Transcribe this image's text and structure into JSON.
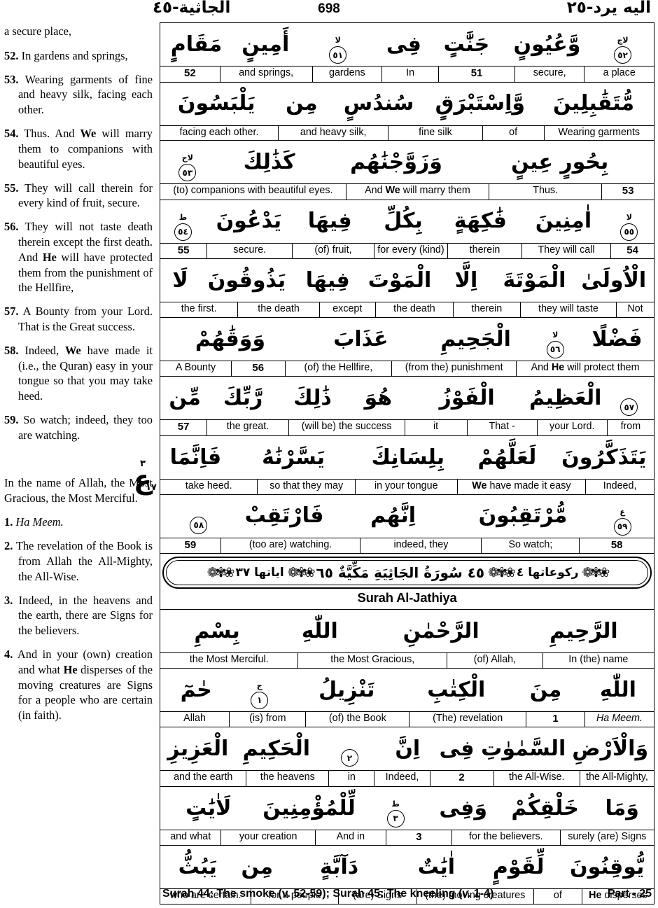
{
  "header": {
    "surah_arabic": "الجاثية-٤٥",
    "page_number": "698",
    "juz_arabic": "اليه يرد-٢٥"
  },
  "hizb_marker": {
    "top": "٣",
    "mid": "ع",
    "bottom": "١٧"
  },
  "left_column": {
    "paragraphs": [
      {
        "num": "",
        "text": "a secure place,",
        "style": "cont"
      },
      {
        "num": "52.",
        "text": "In gardens and springs,"
      },
      {
        "num": "53.",
        "text": "Wearing garments of fine and heavy silk, facing each other."
      },
      {
        "num": "54.",
        "text": "Thus. And <b>We</b> will marry them to companions with beautiful eyes."
      },
      {
        "num": "55.",
        "text": "They will call therein for every kind of fruit, secure."
      },
      {
        "num": "56.",
        "text": "They will not taste death therein except the first death. And <b>He</b> will have protected them from the punishment of the Hellfire,"
      },
      {
        "num": "57.",
        "text": "A Bounty from your Lord. That is the Great success."
      },
      {
        "num": "58.",
        "text": "Indeed, <b>We</b> have made it (i.e., the Quran) easy in your tongue so that you may take heed."
      },
      {
        "num": "59.",
        "text": "So watch; indeed, they too are watching."
      },
      {
        "num": "",
        "text": "",
        "style": "gap"
      },
      {
        "num": "",
        "text": "In the name of Allah, the Most Gracious, the Most Merciful.",
        "style": "cont"
      },
      {
        "num": "1.",
        "text": "<i>Ha Meem.</i>"
      },
      {
        "num": "2.",
        "text": "The revelation of the Book is from Allah the All-Mighty, the All-Wise."
      },
      {
        "num": "3.",
        "text": "Indeed, in the heavens and the earth, there are Signs for the believers."
      },
      {
        "num": "4.",
        "text": "And in your (own) creation and what <b>He</b> disperses of the moving creatures are Signs for a people who are certain (in faith)."
      }
    ]
  },
  "table": {
    "rows": [
      {
        "type": "ayah",
        "arabic": [
          {
            "w": "مَقَامٍ",
            "flex": 1
          },
          {
            "w": "أَمِينٍ",
            "flex": 1
          },
          {
            "w": "۝٥١",
            "mark": "٥١",
            "sup": "لا",
            "flex": 1.1
          },
          {
            "w": "فِى",
            "flex": 0.8
          },
          {
            "w": "جَنَّٰتٍ",
            "flex": 1
          },
          {
            "w": "وَّعُيُونٍ",
            "flex": 1.35
          },
          {
            "w": "۝٥٢",
            "mark": "٥٢",
            "sup": "لاج",
            "flex": 0.85
          }
        ],
        "english": [
          {
            "t": "a place",
            "flex": 1
          },
          {
            "t": "secure,",
            "flex": 1
          },
          {
            "t": "51",
            "flex": 1.1,
            "num": true
          },
          {
            "t": "In",
            "flex": 0.8
          },
          {
            "t": "gardens",
            "flex": 1
          },
          {
            "t": "and springs,",
            "flex": 1.35
          },
          {
            "t": "52",
            "flex": 0.85,
            "num": true
          }
        ]
      },
      {
        "type": "ayah",
        "arabic": [
          {
            "w": "يَلْبَسُونَ",
            "flex": 1.3
          },
          {
            "w": "مِن",
            "flex": 0.7
          },
          {
            "w": "سُندُسٍ",
            "flex": 1.1
          },
          {
            "w": "وَّاِسْتَبْرَقٍ",
            "flex": 1.3
          },
          {
            "w": "مُّتَقَٰبِلِينَ",
            "flex": 1.4
          }
        ],
        "english": [
          {
            "t": "Wearing garments",
            "flex": 1.3
          },
          {
            "t": "of",
            "flex": 0.7
          },
          {
            "t": "fine silk",
            "flex": 1.1
          },
          {
            "t": "and heavy silk,",
            "flex": 1.3
          },
          {
            "t": "facing each other.",
            "flex": 1.4
          }
        ]
      },
      {
        "type": "ayah",
        "arabic": [
          {
            "w": "۝٥٣",
            "mark": "٥٣",
            "sup": "لاج",
            "flex": 0.55
          },
          {
            "w": "كَذَٰلِكَ",
            "flex": 1.25
          },
          {
            "w": "وَزَوَّجْنَٰهُم",
            "flex": 1.6
          },
          {
            "w": "بِحُورٍ عِينٍ",
            "flex": 2.1
          }
        ],
        "english": [
          {
            "t": "53",
            "flex": 0.55,
            "num": true
          },
          {
            "t": "Thus.",
            "flex": 1.25
          },
          {
            "t": "And <b>We</b> will marry them",
            "flex": 1.6
          },
          {
            "t": "(to) companions with beautiful eyes.",
            "flex": 2.1
          }
        ]
      },
      {
        "type": "ayah",
        "arabic": [
          {
            "w": "۝٥٤",
            "mark": "٥٤",
            "sup": "ط",
            "flex": 0.5
          },
          {
            "w": "يَدْعُونَ",
            "flex": 1.1
          },
          {
            "w": "فِيهَا",
            "flex": 0.9
          },
          {
            "w": "بِكُلِّ",
            "flex": 0.9
          },
          {
            "w": "فَٰكِهَةٍ",
            "flex": 1
          },
          {
            "w": "اٰمِنِينَ",
            "flex": 1.05
          },
          {
            "w": "۝٥٥",
            "mark": "٥٥",
            "sup": "لا",
            "flex": 0.55
          }
        ],
        "english": [
          {
            "t": "54",
            "flex": 0.5,
            "num": true
          },
          {
            "t": "They will call",
            "flex": 1.1
          },
          {
            "t": "therein",
            "flex": 0.9
          },
          {
            "t": "for every (kind)",
            "flex": 0.9
          },
          {
            "t": "(of) fruit,",
            "flex": 1
          },
          {
            "t": "secure.",
            "flex": 1.05
          },
          {
            "t": "55",
            "flex": 0.55,
            "num": true
          }
        ]
      },
      {
        "type": "ayah",
        "arabic": [
          {
            "w": "لَا",
            "flex": 0.45
          },
          {
            "w": "يَذُوقُونَ",
            "flex": 1.25
          },
          {
            "w": "فِيهَا",
            "flex": 0.85
          },
          {
            "w": "الْمَوْتَ",
            "flex": 1
          },
          {
            "w": "اِلَّا",
            "flex": 0.7
          },
          {
            "w": "الْمَوْتَةَ",
            "flex": 1.05
          },
          {
            "w": "الْاُولَىٰ",
            "flex": 1
          }
        ],
        "english": [
          {
            "t": "Not",
            "flex": 0.45
          },
          {
            "t": "they will taste",
            "flex": 1.25
          },
          {
            "t": "therein",
            "flex": 0.85
          },
          {
            "t": "the death",
            "flex": 1
          },
          {
            "t": "except",
            "flex": 0.7
          },
          {
            "t": "the death",
            "flex": 1.05
          },
          {
            "t": "the first.",
            "flex": 1
          }
        ]
      },
      {
        "type": "ayah",
        "arabic": [
          {
            "w": "وَوَقَٰهُمْ",
            "flex": 1.5
          },
          {
            "w": "عَذَابَ",
            "flex": 1.35
          },
          {
            "w": "الْجَحِيمِ",
            "flex": 1.15
          },
          {
            "w": "۝٥٦",
            "mark": "٥٦",
            "sup": "لا",
            "flex": 0.55
          },
          {
            "w": "فَضْلًا",
            "flex": 0.75
          }
        ],
        "english": [
          {
            "t": "And <b>He</b> will protect them",
            "flex": 1.5
          },
          {
            "t": "(from the) punishment",
            "flex": 1.35
          },
          {
            "t": "(of) the Hellfire,",
            "flex": 1.15
          },
          {
            "t": "56",
            "flex": 0.55,
            "num": true
          },
          {
            "t": "A Bounty",
            "flex": 0.75
          }
        ]
      },
      {
        "type": "ayah",
        "arabic": [
          {
            "w": "مِّن",
            "flex": 0.55
          },
          {
            "w": "رَّبِّكَ",
            "flex": 0.85
          },
          {
            "w": "ذَٰلِكَ",
            "flex": 0.85
          },
          {
            "w": "هُوَ",
            "flex": 0.75
          },
          {
            "w": "الْفَوْزُ",
            "flex": 1.45
          },
          {
            "w": "الْعَظِيمُ",
            "flex": 1
          },
          {
            "w": "۝٥٧",
            "mark": "٥٧",
            "sup": "",
            "flex": 0.55
          }
        ],
        "english": [
          {
            "t": "from",
            "flex": 0.55
          },
          {
            "t": "your Lord.",
            "flex": 0.85
          },
          {
            "t": "That -",
            "flex": 0.85
          },
          {
            "t": "it",
            "flex": 0.75
          },
          {
            "t": "(will be) the success",
            "flex": 1.45
          },
          {
            "t": "the great.",
            "flex": 1
          },
          {
            "t": "57",
            "flex": 0.55,
            "num": true
          }
        ]
      },
      {
        "type": "ayah",
        "arabic": [
          {
            "w": "فَاِنَّمَا",
            "flex": 0.72
          },
          {
            "w": "يَسَّرْنَٰهُ",
            "flex": 1.4
          },
          {
            "w": "بِلِسَانِكَ",
            "flex": 1.1
          },
          {
            "w": "لَعَلَّهُمْ",
            "flex": 1.05
          },
          {
            "w": "يَتَذَكَّرُونَ",
            "flex": 1.05
          }
        ],
        "english": [
          {
            "t": "Indeed,",
            "flex": 0.72
          },
          {
            "t": "<b>We</b> have made it easy",
            "flex": 1.4
          },
          {
            "t": "in your tongue",
            "flex": 1.1
          },
          {
            "t": "so that they may",
            "flex": 1.05
          },
          {
            "t": "take heed.",
            "flex": 1.05
          }
        ]
      },
      {
        "type": "ayah",
        "arabic": [
          {
            "w": "۝٥٨",
            "mark": "٥٨",
            "sup": "",
            "flex": 0.75
          },
          {
            "w": "فَارْتَقِبْ",
            "flex": 1
          },
          {
            "w": "اِنَّهُم",
            "flex": 1.25
          },
          {
            "w": "مُّرْتَقِبُونَ",
            "flex": 1.45
          },
          {
            "w": "۝٥٩",
            "mark": "٥٩",
            "sup": "ع",
            "flex": 0.6
          }
        ],
        "english": [
          {
            "t": "58",
            "flex": 0.75,
            "num": true
          },
          {
            "t": "So watch;",
            "flex": 1
          },
          {
            "t": "indeed, they",
            "flex": 1.25
          },
          {
            "t": "(too are) watching.",
            "flex": 1.45
          },
          {
            "t": "59",
            "flex": 0.6,
            "num": true
          }
        ]
      }
    ],
    "surah_banner": {
      "right_text": "اياتها ٣٧",
      "center_text": "٤٥ سُورَةُ الجَاثِيَةِ مَكِّيَّةٌ ٦٥",
      "left_text": "ركوعاتها ٤",
      "ornament": "❀✾❁",
      "english_name": "Surah Al-Jathiya"
    },
    "rows2": [
      {
        "type": "ayah",
        "arabic": [
          {
            "w": "بِسْمِ",
            "flex": 1
          },
          {
            "w": "اللّٰهِ",
            "flex": 0.85
          },
          {
            "w": "الرَّحْمٰنِ",
            "flex": 1.35
          },
          {
            "w": "الرَّحِيمِ",
            "flex": 1.25
          }
        ],
        "english": [
          {
            "t": "In (the) name",
            "flex": 1
          },
          {
            "t": "(of) Allah,",
            "flex": 0.85
          },
          {
            "t": "the Most Gracious,",
            "flex": 1.35
          },
          {
            "t": "the Most Merciful.",
            "flex": 1.25
          }
        ]
      },
      {
        "type": "ayah",
        "arabic": [
          {
            "w": "حٰمٓ",
            "flex": 0.72
          },
          {
            "w": "۝١",
            "mark": "١",
            "sup": "ج",
            "flex": 0.6
          },
          {
            "w": "تَنْزِيلُ",
            "flex": 1.25
          },
          {
            "w": "الْكِتٰبِ",
            "flex": 1.1
          },
          {
            "w": "مِنَ",
            "flex": 0.8
          },
          {
            "w": "اللّٰهِ",
            "flex": 0.72
          }
        ],
        "english": [
          {
            "t": "<i>Ha Meem.</i>",
            "flex": 0.72
          },
          {
            "t": "1",
            "flex": 0.6,
            "num": true
          },
          {
            "t": "(The) revelation",
            "flex": 1.25
          },
          {
            "t": "(of) the Book",
            "flex": 1.1
          },
          {
            "t": "(is) from",
            "flex": 0.8
          },
          {
            "t": "Allah",
            "flex": 0.72
          }
        ]
      },
      {
        "type": "ayah",
        "arabic": [
          {
            "w": "الْعَزِيزِ",
            "flex": 0.85
          },
          {
            "w": "الْحَكِيمِ",
            "flex": 1
          },
          {
            "w": "۝٢",
            "mark": "٢",
            "sup": "",
            "flex": 0.72
          },
          {
            "w": "اِنَّ",
            "flex": 0.62
          },
          {
            "w": "فِى",
            "flex": 0.5
          },
          {
            "w": "السَّمٰوٰتِ",
            "flex": 0.95
          },
          {
            "w": "وَالْاَرْضِ",
            "flex": 1
          }
        ],
        "english": [
          {
            "t": "the All-Mighty,",
            "flex": 0.85
          },
          {
            "t": "the All-Wise.",
            "flex": 1
          },
          {
            "t": "2",
            "flex": 0.72,
            "num": true
          },
          {
            "t": "Indeed,",
            "flex": 0.62
          },
          {
            "t": "in",
            "flex": 0.5
          },
          {
            "t": "the heavens",
            "flex": 0.95
          },
          {
            "t": "and the earth",
            "flex": 1
          }
        ]
      },
      {
        "type": "ayah",
        "arabic": [
          {
            "w": "لَاٰيَٰتٍ",
            "flex": 0.95
          },
          {
            "w": "لِّلْمُؤْمِنِينَ",
            "flex": 1.1
          },
          {
            "w": "۝٣",
            "mark": "٣",
            "sup": "ط",
            "flex": 0.65
          },
          {
            "w": "وَفِى",
            "flex": 0.7
          },
          {
            "w": "خَلْقِكُمْ",
            "flex": 0.95
          },
          {
            "w": "وَمَا",
            "flex": 0.6
          }
        ],
        "english": [
          {
            "t": "surely (are) Signs",
            "flex": 0.95
          },
          {
            "t": "for the believers.",
            "flex": 1.1
          },
          {
            "t": "3",
            "flex": 0.65,
            "num": true
          },
          {
            "t": "And in",
            "flex": 0.7
          },
          {
            "t": "your creation",
            "flex": 0.95
          },
          {
            "t": "and what",
            "flex": 0.6
          }
        ]
      },
      {
        "type": "ayah",
        "arabic": [
          {
            "w": "يَبُثُّ",
            "flex": 0.78
          },
          {
            "w": "مِن",
            "flex": 0.5
          },
          {
            "w": "دَآبَّةٍ",
            "flex": 1.3
          },
          {
            "w": "اٰيَٰتٌ",
            "flex": 0.85
          },
          {
            "w": "لِّقَوْمٍ",
            "flex": 0.95
          },
          {
            "w": "يُّوقِنُونَ",
            "flex": 1
          }
        ],
        "english": [
          {
            "t": "<b>He</b> disperses",
            "flex": 0.78
          },
          {
            "t": "of",
            "flex": 0.5
          },
          {
            "t": "(the) moving creatures",
            "flex": 1.3
          },
          {
            "t": "(are) Signs",
            "flex": 0.85
          },
          {
            "t": "for a people",
            "flex": 0.95
          },
          {
            "t": "who are certain.",
            "flex": 1
          }
        ]
      }
    ]
  },
  "footer": {
    "left": "Surah 44: The smoke (v. 52-59); Surah 45: The kneeling (v. 1-4)",
    "right": "Part - 25"
  }
}
